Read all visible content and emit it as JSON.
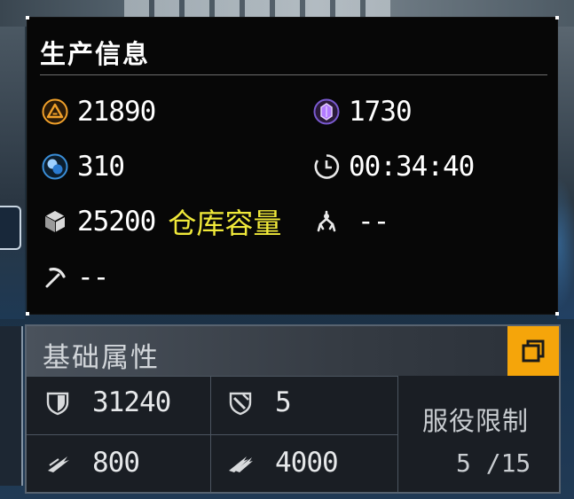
{
  "production_panel": {
    "title": "生产信息",
    "stats": [
      {
        "icon": "alert-triangle-icon",
        "value": "21890"
      },
      {
        "icon": "purple-crystal-icon",
        "value": "1730"
      },
      {
        "icon": "blue-orb-icon",
        "value": "310"
      },
      {
        "icon": "clock-icon",
        "value": "00:34:40"
      },
      {
        "icon": "cube-icon",
        "value": "25200"
      },
      {
        "icon": "claw-icon",
        "value": "--"
      },
      {
        "icon": "pickaxe-icon",
        "value": "--"
      }
    ],
    "storage_label": "仓库容量",
    "storage_label_color": "#f0e93a"
  },
  "attributes_panel": {
    "title": "基础属性",
    "accent_color": "#f5a50a",
    "cells": [
      {
        "icon": "shield-icon",
        "value": "31240"
      },
      {
        "icon": "shield-slash-icon",
        "value": "5"
      },
      {
        "icon": "speed-wing-icon",
        "value": "800"
      },
      {
        "icon": "speed-wing-double-icon",
        "value": "4000"
      }
    ],
    "service_limit_label": "服役限制",
    "service_limit_value": "5 /15"
  }
}
